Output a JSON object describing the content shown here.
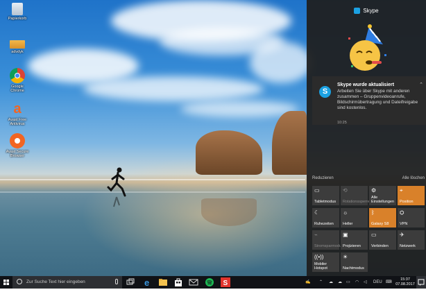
{
  "desktop": {
    "icons": [
      {
        "label": "Papierkorb",
        "icon": "recycle-bin-icon"
      },
      {
        "label": "advdyk",
        "icon": "folder-icon"
      },
      {
        "label": "Google Chrome",
        "icon": "chrome-icon"
      },
      {
        "label": "Avast Free Antivirus",
        "icon": "avast-icon"
      },
      {
        "label": "Avast Secure Browser",
        "icon": "avast-browser-icon"
      }
    ]
  },
  "action_center": {
    "app_name": "Skype",
    "notification": {
      "title": "Skype wurde aktualisiert",
      "body": "Arbeiten Sie über Skype mit anderen zusammen – Gruppenvideoanrufe, Bildschirmübertragung und Dateifreigabe sind kostenlos.",
      "time": "10:25"
    },
    "collapse_label": "Reduzieren",
    "clear_all_label": "Alle löschen",
    "quick_actions": [
      {
        "label": "Tabletmodus",
        "icon": "tablet-mode-icon",
        "state": "off"
      },
      {
        "label": "Rotationssperre",
        "icon": "rotation-lock-icon",
        "state": "dim"
      },
      {
        "label": "Alle Einstellungen",
        "icon": "settings-icon",
        "state": "off"
      },
      {
        "label": "Position",
        "icon": "location-icon",
        "state": "on"
      },
      {
        "label": "Ruhezeiten",
        "icon": "moon-icon",
        "state": "off"
      },
      {
        "label": "Heller",
        "icon": "brightness-icon",
        "state": "off"
      },
      {
        "label": "Galaxy S8",
        "icon": "battery-saver-icon",
        "state": "on"
      },
      {
        "label": "VPN",
        "icon": "vpn-icon",
        "state": "off"
      },
      {
        "label": "Stromsparmodus",
        "icon": "power-saver-icon",
        "state": "dim"
      },
      {
        "label": "Projizieren",
        "icon": "project-icon",
        "state": "off"
      },
      {
        "label": "Verbinden",
        "icon": "connect-icon",
        "state": "off"
      },
      {
        "label": "Netzwerk",
        "icon": "network-icon",
        "state": "off"
      },
      {
        "label": "Mobiler Hotspot",
        "icon": "hotspot-icon",
        "state": "off"
      },
      {
        "label": "Nachtmodus",
        "icon": "night-light-icon",
        "state": "off"
      }
    ]
  },
  "taskbar": {
    "search_placeholder": "Zur Suche Text hier eingeben",
    "language": "DEU",
    "time": "15:37",
    "date": "07.08.2017",
    "pinned": [
      "task-view-icon",
      "edge-icon",
      "file-explorer-icon",
      "store-icon",
      "mail-icon",
      "spotify-icon",
      "avast-taskbar-icon"
    ]
  },
  "colors": {
    "accent": "#d9812a",
    "skype": "#1ba1e2"
  }
}
